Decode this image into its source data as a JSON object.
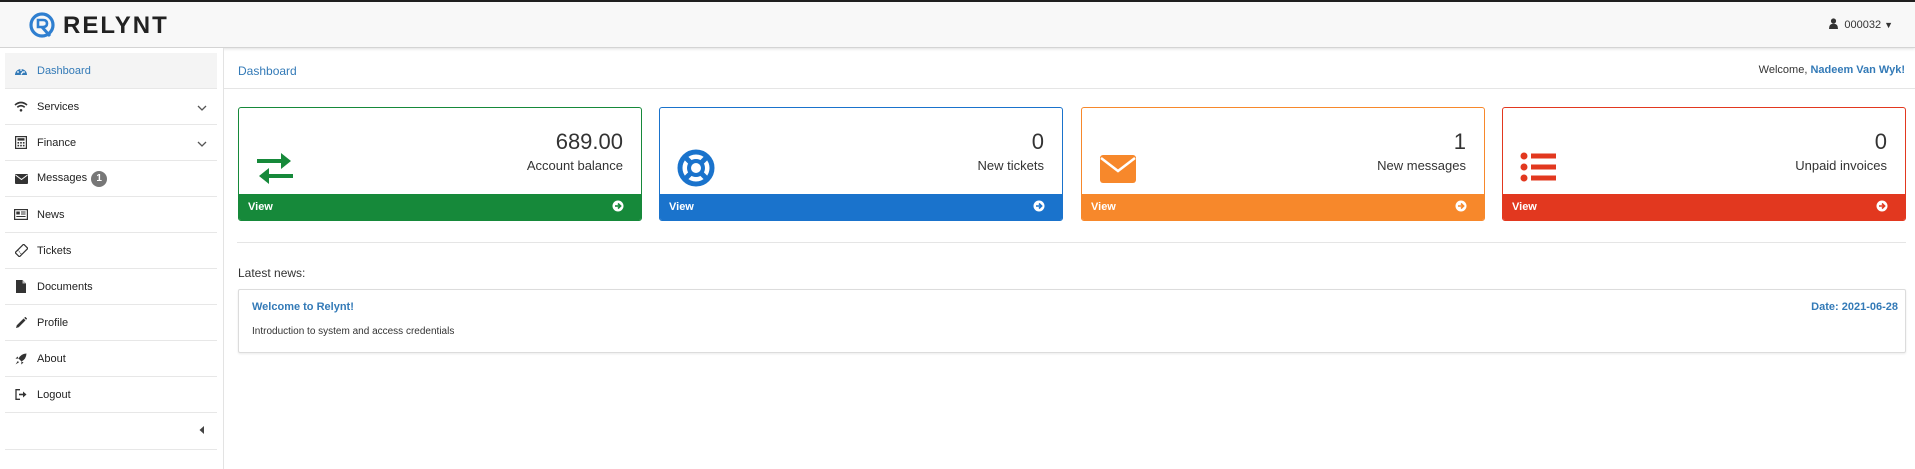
{
  "brand": {
    "name": "RELYNT"
  },
  "user_menu": {
    "account_id": "000032"
  },
  "sidebar": {
    "items": [
      {
        "label": "Dashboard",
        "icon": "dashboard-icon",
        "active": true
      },
      {
        "label": "Services",
        "icon": "wifi-icon",
        "expandable": true
      },
      {
        "label": "Finance",
        "icon": "calculator-icon",
        "expandable": true
      },
      {
        "label": "Messages",
        "icon": "envelope-icon",
        "badge": "1"
      },
      {
        "label": "News",
        "icon": "newspaper-icon"
      },
      {
        "label": "Tickets",
        "icon": "ticket-icon"
      },
      {
        "label": "Documents",
        "icon": "file-icon"
      },
      {
        "label": "Profile",
        "icon": "pencil-icon"
      },
      {
        "label": "About",
        "icon": "rocket-icon"
      },
      {
        "label": "Logout",
        "icon": "sign-out-icon"
      }
    ]
  },
  "header": {
    "breadcrumb": "Dashboard",
    "welcome_prefix": "Welcome,",
    "user_name": "Nadeem Van Wyk!"
  },
  "cards": [
    {
      "value": "689.00",
      "caption": "Account balance",
      "link": "View",
      "color": "#16893a",
      "icon": "exchange-arrows-icon"
    },
    {
      "value": "0",
      "caption": "New tickets",
      "link": "View",
      "color": "#1a73cc",
      "icon": "life-ring-icon"
    },
    {
      "value": "1",
      "caption": "New messages",
      "link": "View",
      "color": "#f7882b",
      "icon": "envelope-icon"
    },
    {
      "value": "0",
      "caption": "Unpaid invoices",
      "link": "View",
      "color": "#e2381f",
      "icon": "list-icon"
    }
  ],
  "news": {
    "section_title": "Latest news:",
    "items": [
      {
        "title": "Welcome to Relynt!",
        "date": "Date: 2021-06-28",
        "summary": "Introduction to system and access credentials"
      }
    ]
  }
}
